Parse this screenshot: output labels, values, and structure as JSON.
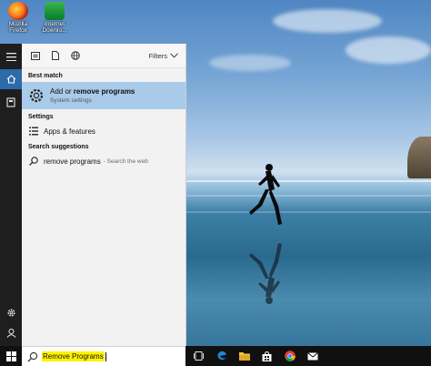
{
  "desktop": {
    "icons": [
      {
        "label_line1": "Mozilla",
        "label_line2": "Firefox",
        "icon": "firefox-icon"
      },
      {
        "label_line1": "Internet",
        "label_line2": "Downlo...",
        "icon": "idm-icon"
      }
    ]
  },
  "rail": {
    "items": [
      {
        "icon": "hamburger-menu-icon"
      },
      {
        "icon": "home-icon",
        "active": true
      },
      {
        "icon": "notebook-icon"
      },
      {
        "icon": "settings-gear-icon"
      },
      {
        "icon": "feedback-icon"
      }
    ]
  },
  "panel": {
    "top_icons": [
      "apps-filter-icon",
      "documents-filter-icon",
      "web-filter-icon"
    ],
    "filters_label": "Filters",
    "best_match_label": "Best match",
    "best_match": {
      "title_prefix": "Add or ",
      "title_bold": "remove programs",
      "subtitle": "System settings",
      "icon": "settings-gear-icon"
    },
    "settings_label": "Settings",
    "settings_items": [
      {
        "label": "Apps & features",
        "icon": "apps-features-icon"
      }
    ],
    "suggestions_label": "Search suggestions",
    "suggestions": [
      {
        "label": "remove programs",
        "hint": "- Search the web",
        "icon": "search-icon"
      }
    ]
  },
  "search": {
    "query": "Remove Programs"
  },
  "taskbar": {
    "items": [
      "task-view-icon",
      "edge-icon",
      "file-explorer-icon",
      "store-icon",
      "chrome-icon",
      "mail-icon"
    ]
  },
  "colors": {
    "highlight": "#a9cbe9",
    "rail_active": "#2d6aa8",
    "query_highlight": "#fff200"
  }
}
